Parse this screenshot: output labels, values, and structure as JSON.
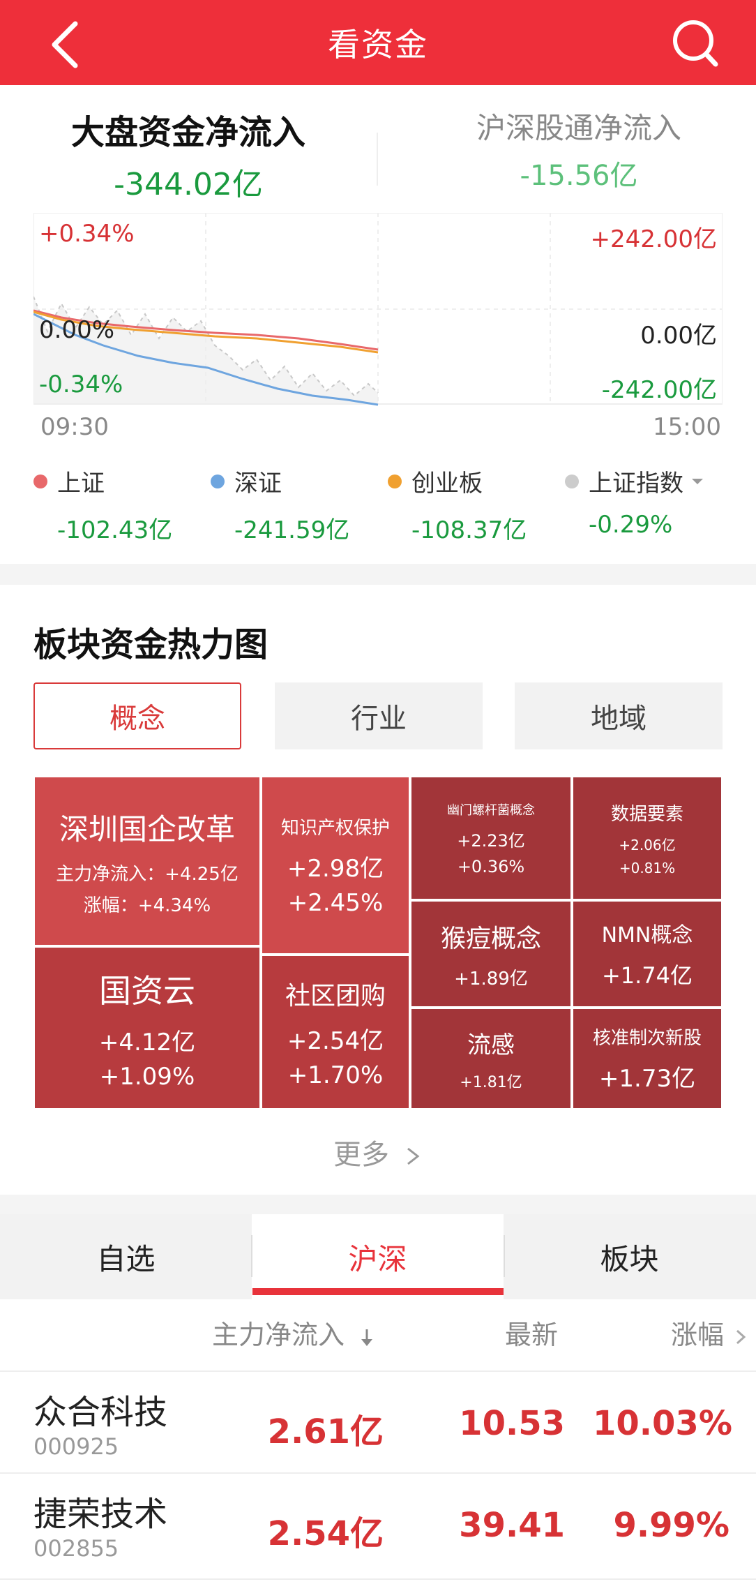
{
  "header": {
    "title": "看资金"
  },
  "flow": {
    "main_label": "大盘资金净流入",
    "main_value": "-344.02亿",
    "north_label": "沪深股通净流入",
    "north_value": "-15.56亿"
  },
  "chart": {
    "left_top": "+0.34%",
    "left_mid": "0.00%",
    "left_bottom": "-0.34%",
    "right_top": "+242.00亿",
    "right_mid": "0.00亿",
    "right_bottom": "-242.00亿",
    "time_start": "09:30",
    "time_end": "15:00"
  },
  "legend": [
    {
      "name": "上证",
      "value": "-102.43亿",
      "color": "#e8686a"
    },
    {
      "name": "深证",
      "value": "-241.59亿",
      "color": "#6ea5df"
    },
    {
      "name": "创业板",
      "value": "-108.37亿",
      "color": "#f0a030"
    },
    {
      "name": "上证指数",
      "value": "-0.29%",
      "color": "#cccccc"
    }
  ],
  "heatmap_section": {
    "title": "板块资金热力图",
    "tabs": [
      "概念",
      "行业",
      "地域"
    ],
    "more": "更多"
  },
  "heat": {
    "c1": {
      "name": "深圳国企改革",
      "line1": "主力净流入：+4.25亿",
      "line2": "涨幅：+4.34%"
    },
    "c2": {
      "name": "知识产权保护",
      "line1": "+2.98亿",
      "line2": "+2.45%"
    },
    "c3": {
      "name": "幽门螺杆菌概念",
      "line1": "+2.23亿",
      "line2": "+0.36%"
    },
    "c4": {
      "name": "数据要素",
      "line1": "+2.06亿",
      "line2": "+0.81%"
    },
    "c5": {
      "name": "国资云",
      "line1": "+4.12亿",
      "line2": "+1.09%"
    },
    "c6": {
      "name": "社区团购",
      "line1": "+2.54亿",
      "line2": "+1.70%"
    },
    "c7": {
      "name": "猴痘概念",
      "line1": "+1.89亿"
    },
    "c8": {
      "name": "NMN概念",
      "line1": "+1.74亿"
    },
    "c9": {
      "name": "流感",
      "line1": "+1.81亿"
    },
    "c10": {
      "name": "核准制次新股",
      "line1": "+1.73亿"
    }
  },
  "market_tabs": [
    "自选",
    "沪深",
    "板块"
  ],
  "table": {
    "col_flow": "主力净流入",
    "col_latest": "最新",
    "col_change": "涨幅",
    "rows": [
      {
        "name": "众合科技",
        "code": "000925",
        "flow": "2.61亿",
        "latest": "10.53",
        "change": "10.03%"
      },
      {
        "name": "捷荣技术",
        "code": "002855",
        "flow": "2.54亿",
        "latest": "39.41",
        "change": "9.99%"
      }
    ]
  }
}
